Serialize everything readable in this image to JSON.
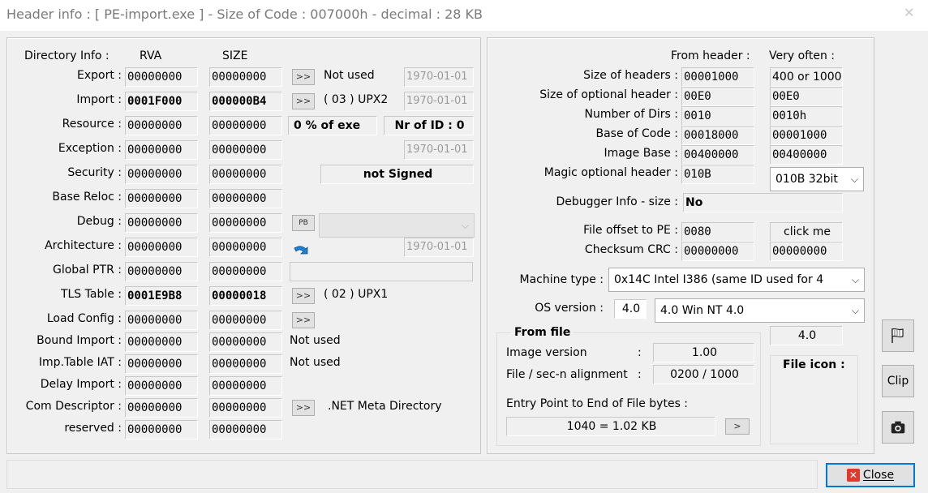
{
  "window": {
    "title": "Header info  : [ PE-import.exe ] - Size of Code : 007000h - decimal : 28 KB"
  },
  "directory": {
    "heading": "Directory Info :",
    "col_rva": "RVA",
    "col_size": "SIZE",
    "rows": [
      {
        "label": "Export :",
        "rva": "00000000",
        "size": "00000000",
        "extra": "Not used",
        "date": "1970-01-01"
      },
      {
        "label": "Import :",
        "rva": "0001F000",
        "size": "000000B4",
        "extra": "( 03 ) UPX2",
        "date": "1970-01-01"
      },
      {
        "label": "Resource :",
        "rva": "00000000",
        "size": "00000000",
        "pct": "0  % of exe",
        "nrid": "Nr of ID : 0"
      },
      {
        "label": "Exception :",
        "rva": "00000000",
        "size": "00000000",
        "date": "1970-01-01"
      },
      {
        "label": "Security :",
        "rva": "00000000",
        "size": "00000000",
        "signed": "not Signed"
      },
      {
        "label": "Base Reloc :",
        "rva": "00000000",
        "size": "00000000"
      },
      {
        "label": "Debug :",
        "rva": "00000000",
        "size": "00000000",
        "pb": "PB"
      },
      {
        "label": "Architecture :",
        "rva": "00000000",
        "size": "00000000",
        "date": "1970-01-01"
      },
      {
        "label": "Global PTR :",
        "rva": "00000000",
        "size": "00000000"
      },
      {
        "label": "TLS Table :",
        "rva": "0001E9B8",
        "size": "00000018",
        "extra": "( 02 ) UPX1"
      },
      {
        "label": "Load Config :",
        "rva": "00000000",
        "size": "00000000"
      },
      {
        "label": "Bound Import :",
        "rva": "00000000",
        "size": "00000000",
        "extra": "Not used"
      },
      {
        "label": "Imp.Table IAT :",
        "rva": "00000000",
        "size": "00000000",
        "extra": "Not used"
      },
      {
        "label": "Delay Import :",
        "rva": "00000000",
        "size": "00000000"
      },
      {
        "label": "Com Descriptor :",
        "rva": "00000000",
        "size": "00000000",
        "extra": ".NET Meta Directory"
      },
      {
        "label": "reserved :",
        "rva": "00000000",
        "size": "00000000"
      }
    ],
    "arrow_btn": ">>"
  },
  "header": {
    "from_header": "From header :",
    "very_often": "Very often :",
    "size_headers_lbl": "Size of headers :",
    "size_headers": "00001000",
    "size_headers_often": "400 or 1000",
    "size_opt_lbl": "Size of optional header :",
    "size_opt": "00E0",
    "size_opt_often": "00E0",
    "num_dirs_lbl": "Number of Dirs :",
    "num_dirs": "0010",
    "num_dirs_often": "0010h",
    "base_code_lbl": "Base of Code :",
    "base_code": "00018000",
    "base_code_often": "00001000",
    "image_base_lbl": "Image Base :",
    "image_base": "00400000",
    "image_base_often": "00400000",
    "magic_lbl": "Magic optional header :",
    "magic": "010B",
    "magic_combo": "010B 32bit",
    "debugger_lbl": "Debugger Info  - size :",
    "debugger": "No",
    "offset_pe_lbl": "File offset to PE :",
    "offset_pe": "0080",
    "click_me": "click me",
    "checksum_lbl": "Checksum CRC :",
    "checksum": "00000000",
    "checksum_often": "00000000",
    "machine_lbl": "Machine type :",
    "machine": "0x14C   Intel I386 (same ID used for 4",
    "os_lbl": "OS version :",
    "os_short": "4.0",
    "os_combo": "4.0  Win NT 4.0"
  },
  "from_file": {
    "heading": "From file",
    "image_version_lbl": "Image version",
    "colon": ":",
    "image_version": "1.00",
    "align_lbl": "File / sec-n alignment",
    "align": "0200  /  1000",
    "entry_lbl": "Entry Point to End of File bytes :",
    "entry": "1040  =  1.02 KB",
    "entry_btn": ">",
    "version_box": "4.0",
    "file_icon_lbl": "File icon :"
  },
  "buttons": {
    "clip": "Clip",
    "close": "Close"
  }
}
